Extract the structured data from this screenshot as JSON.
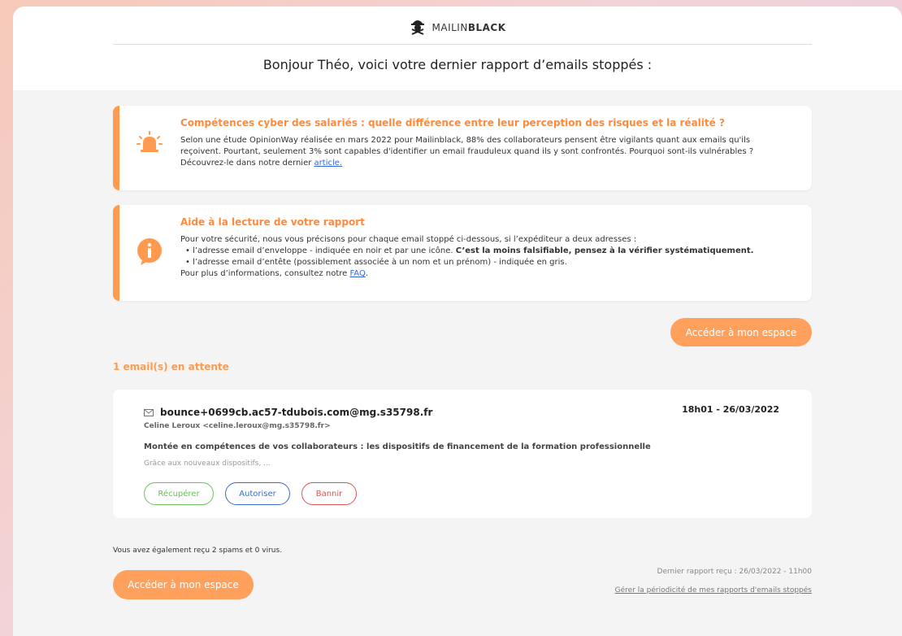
{
  "brand": {
    "logo_icon": "pirate-mask-icon",
    "name_prefix": "MAILIN",
    "name_bold": "BLACK",
    "accent": "#ff9a4f"
  },
  "greeting": "Bonjour Théo, voici votre dernier rapport d’emails stoppés :",
  "info_cards": {
    "cyber": {
      "icon": "alarm-bell-icon",
      "title": "Compétences cyber des salariés : quelle différence entre leur perception des risques et la réalité ?",
      "line1": "Selon une étude OpinionWay réalisée en mars 2022 pour Mailinblack, 88% des collaborateurs pensent être vigilants quant aux emails qu'ils",
      "line2": "reçoivent. Pourtant, seulement 3% sont capables d'identifier un email frauduleux quand ils y sont confrontés. Pourquoi sont-ils vulnérables ?",
      "line3_prefix": "Découvrez-le dans notre dernier ",
      "link_text": "article."
    },
    "help": {
      "icon": "info-icon",
      "title": "Aide à la lecture de votre rapport",
      "intro": "Pour votre sécurité, nous vous précisons pour chaque email stoppé ci-dessous, si l’expéditeur a deux adresses :",
      "bullet1": "• l’adresse email d’enveloppe - indiquée en noir et par une icône. ",
      "bullet1_bold": "C’est la moins falsifiable, pensez à la vérifier systématiquement.",
      "bullet2": "• l’adresse email d’entête (possiblement associée à un nom et un prénom) - indiquée en gris.",
      "outro_prefix": "Pour plus d’informations, consultez notre ",
      "faq_link": "FAQ",
      "outro_suffix": "."
    }
  },
  "cta_label": "Accéder à mon espace",
  "pending_title": "1 email(s) en attente",
  "email": {
    "envelope_icon": "envelope-icon",
    "sender": "bounce+0699cb.ac57-tdubois.com@mg.s35798.fr",
    "date": "18h01 - 26/03/2022",
    "header_from": "Celine Leroux <celine.leroux@mg.s35798.fr>",
    "subject": "Montée en compétences de vos collaborateurs : les dispositifs de financement de la formation professionnelle",
    "preview": "Grâce aux nouveaux dispositifs, ...",
    "actions": {
      "recover": "Récupérer",
      "allow": "Autoriser",
      "ban": "Bannir"
    }
  },
  "summary": "Vous avez également reçu 2 spams et 0 virus.",
  "footer": {
    "last_report": "Dernier rapport reçu : 26/03/2022 - 11h00",
    "manage_link": "Gérer la périodicité de mes rapports d'emails stoppés"
  }
}
